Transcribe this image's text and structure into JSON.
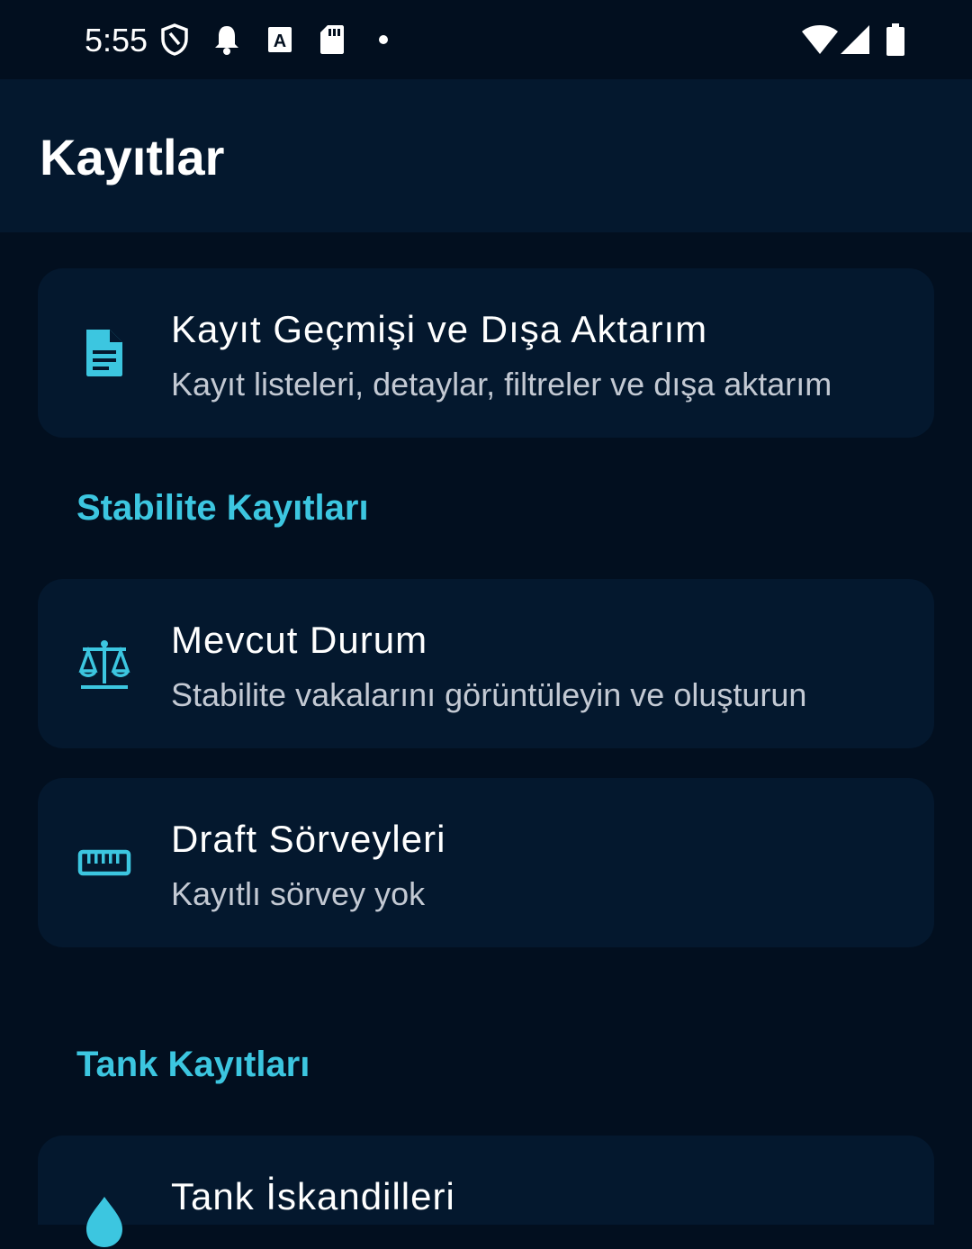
{
  "status_bar": {
    "time": "5:55",
    "icons": [
      "shield-icon",
      "bell-icon",
      "a-box-icon",
      "sd-card-icon",
      "dot-icon",
      "wifi-icon",
      "signal-icon",
      "battery-icon"
    ]
  },
  "app_bar": {
    "title": "Kayıtlar"
  },
  "records": {
    "title": "Kayıt Geçmişi ve Dışa Aktarım",
    "subtitle": "Kayıt listeleri, detaylar, filtreler ve dışa aktarım",
    "icon": "document-icon"
  },
  "stability": {
    "header": "Stabilite Kayıtları",
    "items": [
      {
        "title": "Mevcut Durum",
        "subtitle": "Stabilite vakalarını görüntüleyin ve oluşturun",
        "icon": "scale-icon"
      },
      {
        "title": "Draft Sörveyleri",
        "subtitle": "Kayıtlı sörvey yok",
        "icon": "ruler-icon"
      }
    ]
  },
  "tank": {
    "header": "Tank Kayıtları",
    "items": [
      {
        "title": "Tank İskandilleri",
        "icon": "water-drop-icon"
      }
    ]
  },
  "colors": {
    "background": "#020f1f",
    "surface": "#04182e",
    "accent": "#3cc6e0",
    "text_primary": "#ffffff",
    "text_secondary": "#c3c9d3"
  }
}
